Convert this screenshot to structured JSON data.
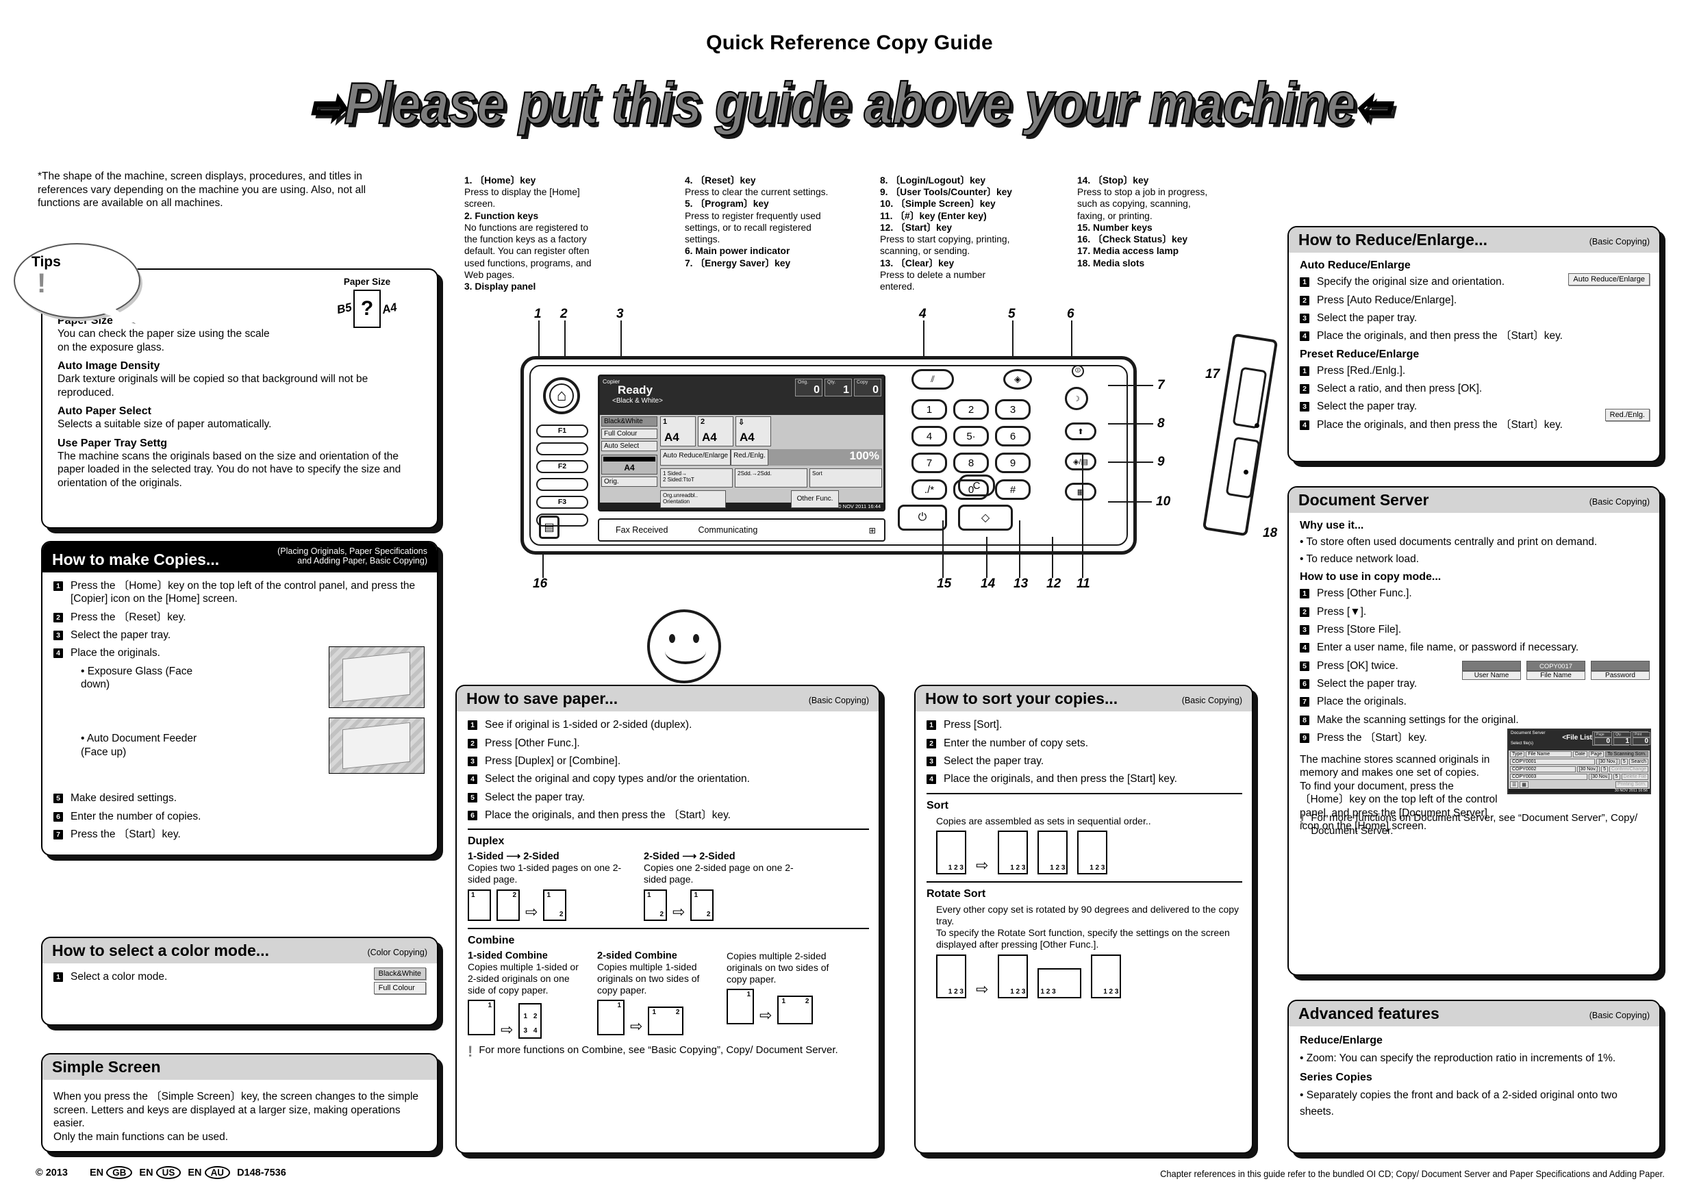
{
  "header": {
    "doc_title": "Quick Reference Copy Guide",
    "banner_left_arrow": "⇨",
    "banner_text": "Please put this guide above your machine",
    "banner_right_arrow": "⇦"
  },
  "top_note": "*The shape of the machine, screen displays, procedures, and titles in references vary depending on the machine you are using. Also, not all functions are available on all machines.",
  "tips": {
    "bubble_label": "Tips",
    "paper_size_art_label": "Paper Size",
    "art_b5": "B5",
    "art_a4": "A4",
    "art_q": "?",
    "items": [
      {
        "head": "Paper Size",
        "body": "You can check the paper size using the scale on the exposure glass."
      },
      {
        "head": "Auto Image Density",
        "body": "Dark texture originals will be copied so that background will not be reproduced."
      },
      {
        "head": "Auto Paper Select",
        "body": "Selects a suitable size of paper automatically."
      },
      {
        "head": "Use Paper Tray Settg",
        "body": "The machine scans the originals based on the size and orientation of the paper loaded in the selected tray. You do not have to specify the size and orientation of the originals."
      }
    ]
  },
  "legend": {
    "col1": [
      {
        "n": "1.",
        "key": "〔Home〕key",
        "desc": "Press to display the [Home] screen."
      },
      {
        "n": "2.",
        "key": "Function keys",
        "desc": "No functions are registered to the function keys as a factory default. You can register often used functions, programs, and Web pages."
      },
      {
        "n": "3.",
        "key": "Display panel",
        "desc": ""
      }
    ],
    "col2": [
      {
        "n": "4.",
        "key": "〔Reset〕key",
        "desc": "Press to clear the current settings."
      },
      {
        "n": "5.",
        "key": "〔Program〕key",
        "desc": "Press to register frequently used settings, or to recall registered settings."
      },
      {
        "n": "6.",
        "key": "Main power indicator",
        "desc": ""
      },
      {
        "n": "7.",
        "key": "〔Energy Saver〕key",
        "desc": ""
      }
    ],
    "col3": [
      {
        "n": "8.",
        "key": "〔Login/Logout〕key",
        "desc": ""
      },
      {
        "n": "9.",
        "key": "〔User Tools/Counter〕key",
        "desc": ""
      },
      {
        "n": "10.",
        "key": "〔Simple Screen〕key",
        "desc": ""
      },
      {
        "n": "11.",
        "key": "〔#〕key (Enter key)",
        "desc": ""
      },
      {
        "n": "12.",
        "key": "〔Start〕key",
        "desc": "Press to start copying, printing, scanning, or sending."
      },
      {
        "n": "13.",
        "key": "〔Clear〕key",
        "desc": "Press to delete a number entered."
      }
    ],
    "col4": [
      {
        "n": "14.",
        "key": "〔Stop〕key",
        "desc": "Press to stop a job in progress, such as copying, scanning, faxing, or printing."
      },
      {
        "n": "15.",
        "key": "Number keys",
        "desc": ""
      },
      {
        "n": "16.",
        "key": "〔Check Status〕key",
        "desc": ""
      },
      {
        "n": "17.",
        "key": "Media access lamp",
        "desc": ""
      },
      {
        "n": "18.",
        "key": "Media slots",
        "desc": ""
      }
    ]
  },
  "control_panel": {
    "callouts": [
      "1",
      "2",
      "3",
      "4",
      "5",
      "6",
      "7",
      "8",
      "9",
      "10",
      "11",
      "12",
      "13",
      "14",
      "15",
      "16",
      "17",
      "18"
    ],
    "function_keys": [
      "F1",
      "F2",
      "F3"
    ],
    "numpad": [
      "1",
      "2",
      "3",
      "4",
      "5·",
      "6",
      "7",
      "8",
      "9",
      "./*",
      "0",
      "#"
    ],
    "clear_key": "C",
    "lcd": {
      "app": "Copier",
      "status": "Ready",
      "color_mode": "<Black & White>",
      "counters": [
        {
          "label": "Orig.",
          "value": "0"
        },
        {
          "label": "Qty.",
          "value": "1"
        },
        {
          "label": "Copy",
          "value": "0"
        }
      ],
      "left_buttons": [
        "Black&White",
        "Full Colour",
        "Auto Select"
      ],
      "tray_label": "A4",
      "orig_button": "Orig.",
      "paper_cells": [
        {
          "n": "1",
          "size": "A4"
        },
        {
          "n": "2",
          "size": "A4"
        },
        {
          "n": "",
          "size": "A4"
        }
      ],
      "auto_re": "Auto Reduce/Enlarge",
      "red_enlg": "Red./Enlg.",
      "ratio": "100%",
      "duplex_btn": "1 Sided→\n2 Sided:TtoT",
      "duplex_btn_line1": "1 Sided→",
      "duplex_btn_line2": "2 Sided:TtoT",
      "combine_btn": "2Sdd.→2Sdd.",
      "sort_btn": "Sort",
      "orient_line1": "Org.unreadbl..",
      "orient_line2": "Orientation",
      "other_func": "Other Func.",
      "timestamp": "30 NOV  2011  16:44"
    },
    "fax_bar": {
      "left": "Fax Received",
      "center": "Communicating"
    }
  },
  "how_to_make_copies": {
    "title": "How to make Copies...",
    "ref_line1": "(Placing Originals, Paper Specifications",
    "ref_line2": "and Adding Paper, Basic Copying)",
    "steps": [
      "Press the 〔Home〕key on the top left of the control panel, and press the [Copier] icon on the [Home] screen.",
      "Press the 〔Reset〕key.",
      "Select the paper tray.",
      "Place the originals.",
      "Make desired settings.",
      "Enter the number of copies.",
      "Press the 〔Start〕key."
    ],
    "sub_a": "• Exposure Glass (Face down)",
    "sub_b": "• Auto Document Feeder (Face up)"
  },
  "color_mode": {
    "title": "How to select a color mode...",
    "ref": "(Color Copying)",
    "step": "Select a color mode.",
    "buttons": [
      "Black&White",
      "Full Colour"
    ]
  },
  "simple_screen": {
    "title": "Simple Screen",
    "body": "When you press the 〔Simple Screen〕key, the screen changes to the simple screen. Letters and keys are displayed at a larger size, making operations easier.\nOnly the main functions can be used."
  },
  "save_paper": {
    "title": "How to save paper...",
    "ref": "(Basic Copying)",
    "steps": [
      "See if original is 1-sided or 2-sided (duplex).",
      "Press [Other Func.].",
      "Press [Duplex] or [Combine].",
      "Select the original and copy types and/or the orientation.",
      "Select the paper tray.",
      "Place the originals, and then press the 〔Start〕key."
    ],
    "duplex_title": "Duplex",
    "duplex_items": [
      {
        "head": "1-Sided ⟶ 2-Sided",
        "body": "Copies two 1-sided pages on one 2-sided page."
      },
      {
        "head": "2-Sided ⟶ 2-Sided",
        "body": "Copies one 2-sided page on one 2-sided page."
      }
    ],
    "combine_title": "Combine",
    "combine_items": [
      {
        "head": "1-sided Combine",
        "body": "Copies multiple 1-sided or 2-sided originals on one side of copy paper."
      },
      {
        "head": "2-sided Combine",
        "body": "Copies multiple 1-sided originals on two sides of copy paper."
      },
      {
        "head": "",
        "body": "Copies multiple 2-sided originals on two sides of copy paper."
      }
    ],
    "note": "For more functions on Combine, see “Basic Copying”, Copy/ Document Server."
  },
  "sort_copies": {
    "title": "How to sort your copies...",
    "ref": "(Basic Copying)",
    "steps": [
      "Press [Sort].",
      "Enter the number of copy sets.",
      "Select the paper tray.",
      "Place the originals, and then press the [Start] key."
    ],
    "sort_title": "Sort",
    "sort_body": "Copies are assembled as sets in sequential order..",
    "rotate_title": "Rotate Sort",
    "rotate_body": "Every other copy set is rotated by 90 degrees and delivered to the copy tray.\nTo specify the Rotate Sort function, specify the settings on the screen displayed after pressing [Other Func.]."
  },
  "reduce_enlarge": {
    "title": "How to Reduce/Enlarge...",
    "ref": "(Basic Copying)",
    "auto_title": "Auto Reduce/Enlarge",
    "auto_steps": [
      "Specify the original size and orientation.",
      "Press [Auto Reduce/Enlarge].",
      "Select the paper tray.",
      "Place the originals, and then press the 〔Start〕key."
    ],
    "auto_button": "Auto Reduce/Enlarge",
    "preset_title": "Preset Reduce/Enlarge",
    "preset_steps": [
      "Press [Red./Enlg.].",
      "Select a ratio, and then press [OK].",
      "Select the paper tray.",
      "Place the originals, and then press the 〔Start〕key."
    ],
    "preset_button": "Red./Enlg."
  },
  "document_server": {
    "title": "Document Server",
    "ref": "(Basic Copying)",
    "why_title": "Why use it...",
    "why_items": [
      "• To store often used documents centrally and print on demand.",
      "• To reduce network load."
    ],
    "how_title": "How to use in copy mode...",
    "steps": [
      "Press [Other Func.].",
      "Press [▼].",
      "Press [Store File].",
      "Enter a user name, file name, or password if necessary.",
      "Press [OK] twice.",
      "Select the paper tray.",
      "Place the originals.",
      "Make the scanning settings for the original.",
      "Press the 〔Start〕key."
    ],
    "fields": [
      {
        "top": "",
        "bot": "User Name"
      },
      {
        "top": "COPY0017",
        "bot": "File Name"
      },
      {
        "top": "",
        "bot": "Password"
      }
    ],
    "body": "The machine stores scanned originals in memory and makes one set of copies.\nTo find your document, press the 〔Home〕key on the top left of the control panel, and press the [Document Server] icon on the [Home] screen.",
    "note": "For more functions on Document Server, see “Document Server”, Copy/ Document Server.",
    "mini_screen": {
      "app": "Document Server",
      "title": "<File List>",
      "subtitle": "Select file(s)",
      "counters": [
        {
          "label": "Page",
          "value": "0"
        },
        {
          "label": "Qty.",
          "value": "1"
        },
        {
          "label": "Print",
          "value": "0"
        }
      ],
      "headers": [
        "Type",
        "File Name",
        "Date",
        "Page"
      ],
      "rows": [
        {
          "name": "COPY0001",
          "date": "[30 Nov.]",
          "page": "5"
        },
        {
          "name": "COPY0002",
          "date": "[30 Nov.]",
          "page": "5"
        },
        {
          "name": "COPY0003",
          "date": "[30 Nov.]",
          "page": "5"
        }
      ],
      "side_buttons": [
        "To Scanning Scrn.",
        "Search",
        "Confirm/Change",
        "Delete File",
        "Printing Scrn."
      ],
      "timestamp": "30 NOV  2011  16:56"
    }
  },
  "advanced": {
    "title": "Advanced features",
    "ref": "(Basic Copying)",
    "groups": [
      {
        "head": "Reduce/Enlarge",
        "item": "• Zoom: You can specify the reproduction ratio in increments of 1%."
      },
      {
        "head": "Series Copies",
        "item": "• Separately copies the front and back of a 2-sided original onto two sheets."
      }
    ]
  },
  "footer": {
    "copyright": "© 2013",
    "regions": [
      {
        "pre": "EN",
        "tag": "GB"
      },
      {
        "pre": "EN",
        "tag": "US"
      },
      {
        "pre": "EN",
        "tag": "AU"
      }
    ],
    "part_no": "D148-7536",
    "right_note": "Chapter references in this guide refer to the bundled OI CD; Copy/ Document Server and Paper Specifications and Adding Paper."
  }
}
